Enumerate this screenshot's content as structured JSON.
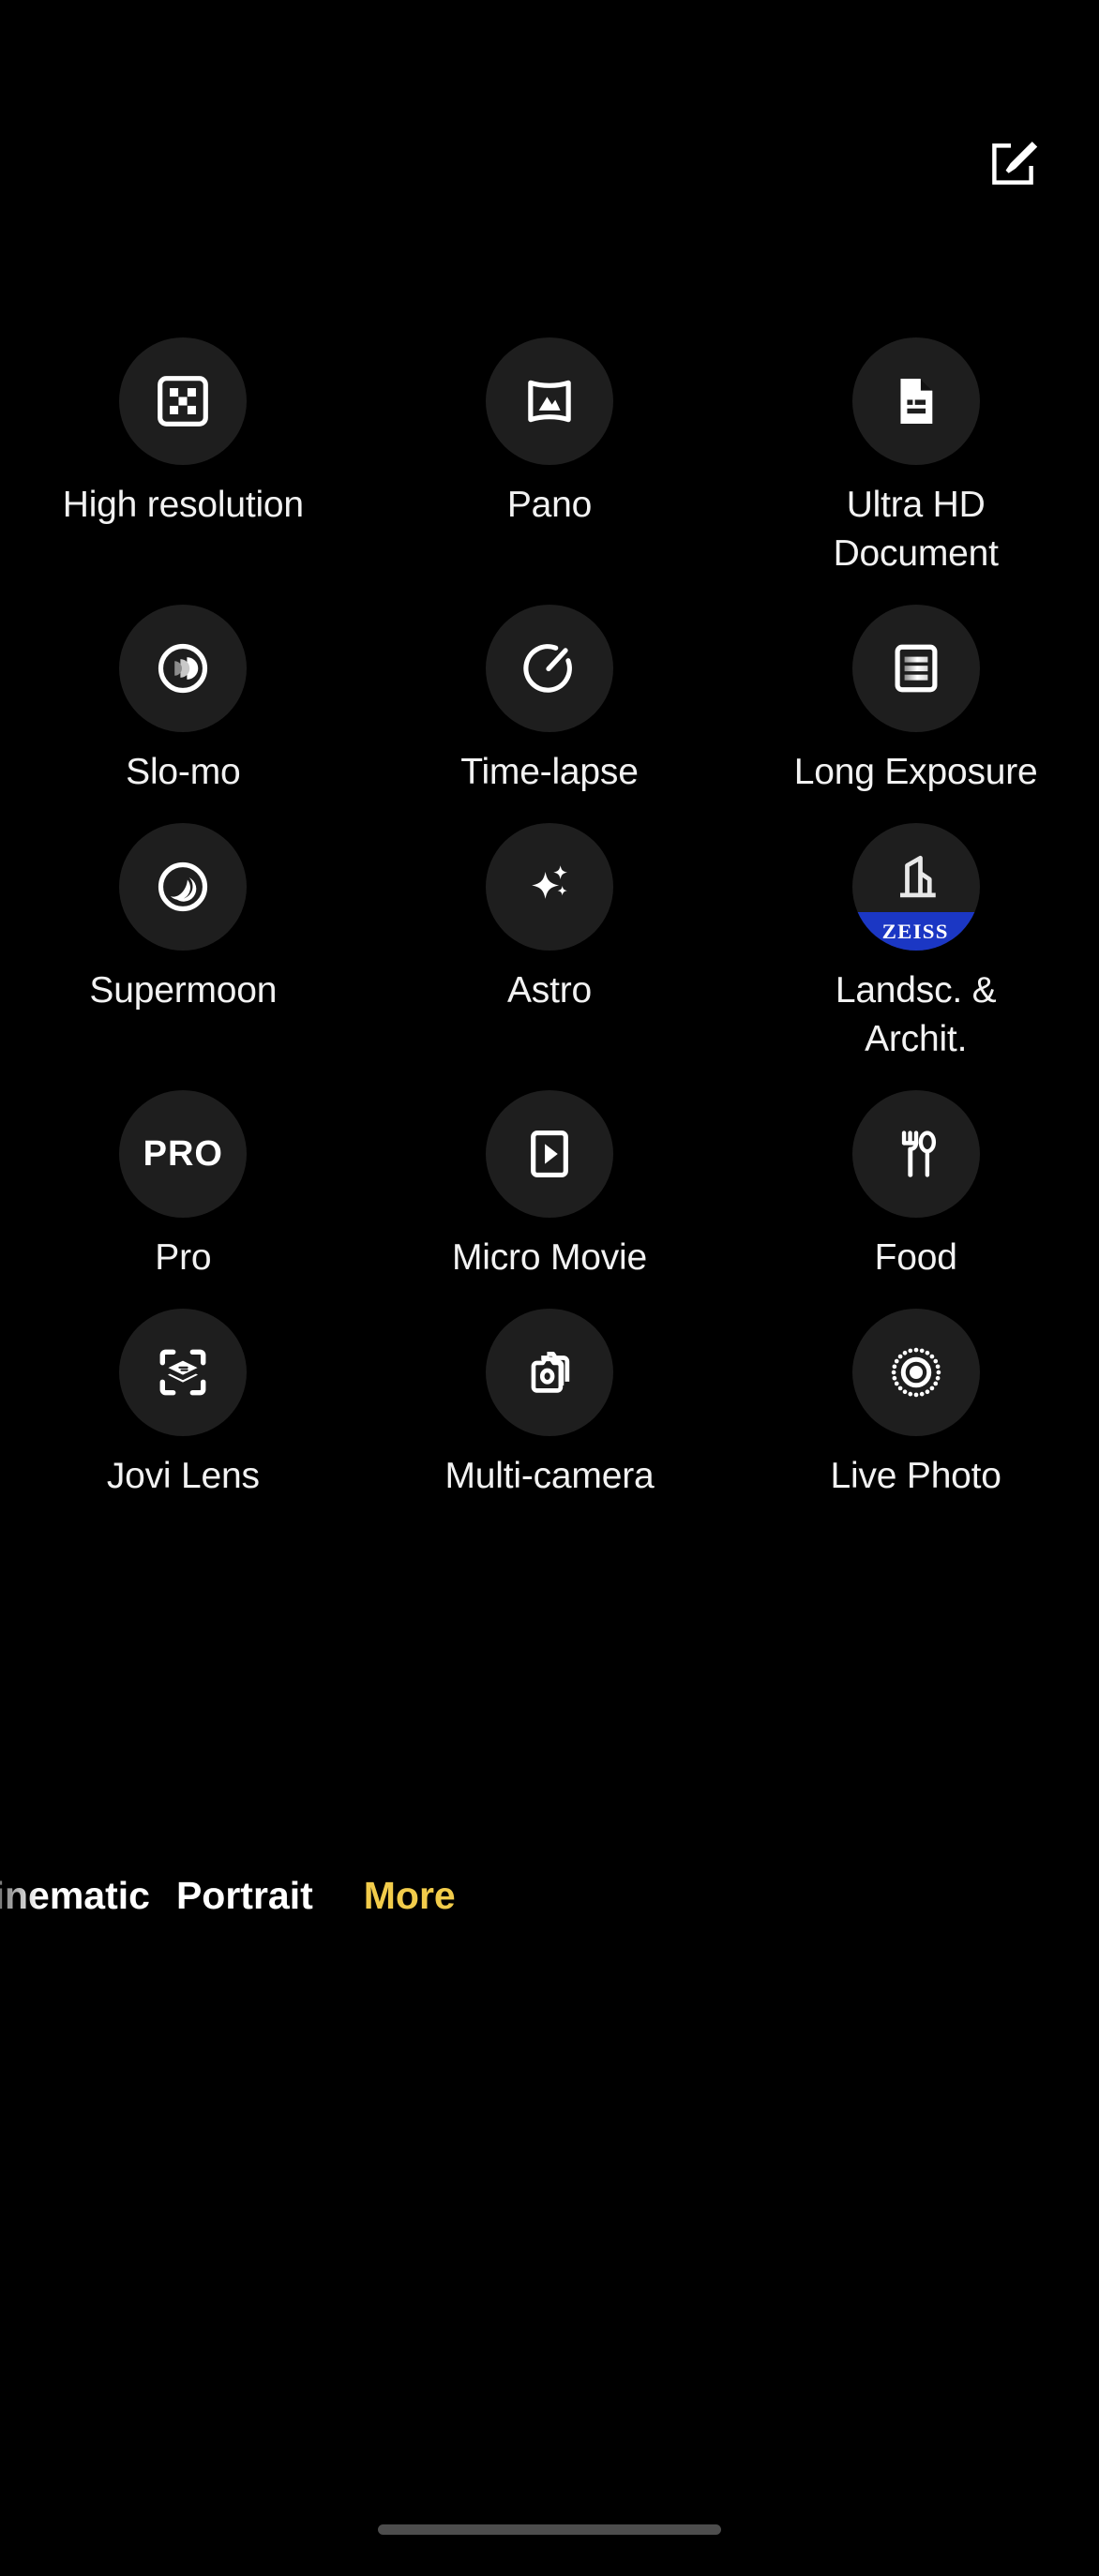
{
  "app": {
    "background_color": "#000000",
    "circle_color": "#1e1e1e",
    "accent_color": "#f2cc4b",
    "zeiss_blue": "#1b37c4"
  },
  "topbar": {
    "edit_button_label": "Edit",
    "edit_icon": "edit-square-pencil-icon"
  },
  "mode_grid": {
    "columns": 3,
    "items": [
      {
        "id": "high-resolution",
        "label": "High\nresolution",
        "icon": "high-resolution-icon"
      },
      {
        "id": "pano",
        "label": "Pano",
        "icon": "panorama-icon"
      },
      {
        "id": "ultra-hd-document",
        "label": "Ultra HD\nDocument",
        "icon": "document-icon"
      },
      {
        "id": "slo-mo",
        "label": "Slo-mo",
        "icon": "slow-motion-icon"
      },
      {
        "id": "time-lapse",
        "label": "Time-lapse",
        "icon": "time-lapse-gauge-icon"
      },
      {
        "id": "long-exposure",
        "label": "Long\nExposure",
        "icon": "long-exposure-icon"
      },
      {
        "id": "supermoon",
        "label": "Supermoon",
        "icon": "moon-icon"
      },
      {
        "id": "astro",
        "label": "Astro",
        "icon": "sparkle-star-icon"
      },
      {
        "id": "landscape-architecture",
        "label": "Landsc. &\nArchit.",
        "icon": "building-icon",
        "badge": "ZEISS"
      },
      {
        "id": "pro",
        "label": "Pro",
        "icon": "pro-text-icon",
        "icon_text": "PRO"
      },
      {
        "id": "micro-movie",
        "label": "Micro Movie",
        "icon": "play-video-icon"
      },
      {
        "id": "food",
        "label": "Food",
        "icon": "fork-spoon-icon"
      },
      {
        "id": "jovi-lens",
        "label": "Jovi Lens",
        "icon": "scan-layers-icon"
      },
      {
        "id": "multi-camera",
        "label": "Multi-camera",
        "icon": "multi-camera-icon"
      },
      {
        "id": "live-photo",
        "label": "Live Photo",
        "icon": "live-photo-icon"
      }
    ]
  },
  "mode_strip": {
    "items": [
      {
        "id": "cinematic",
        "label": "Cinematic",
        "state": "faded"
      },
      {
        "id": "portrait",
        "label": "Portrait",
        "state": "inactive"
      },
      {
        "id": "more",
        "label": "More",
        "state": "active"
      }
    ]
  },
  "system": {
    "home_indicator": "home-indicator-bar"
  }
}
